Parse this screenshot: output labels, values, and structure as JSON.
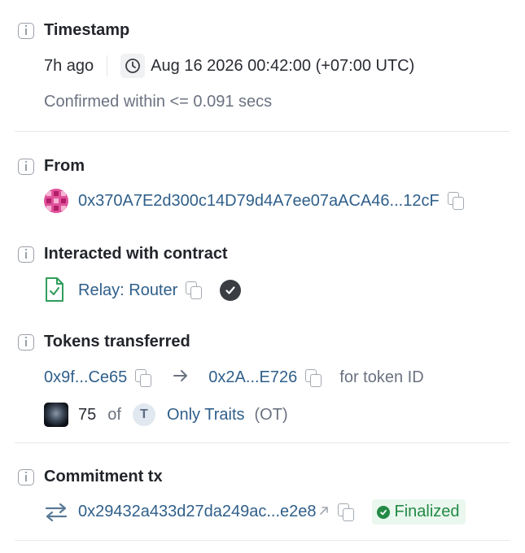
{
  "timestamp": {
    "heading": "Timestamp",
    "relative": "7h ago",
    "absolute": "Aug 16 2026 00:42:00 (+07:00 UTC)",
    "confirmed": "Confirmed within <= 0.091 secs"
  },
  "from": {
    "heading": "From",
    "address": "0x370A7E2d300c14D79d4A7ee07aACA46...12cF"
  },
  "contract": {
    "heading": "Interacted with contract",
    "name": "Relay: Router"
  },
  "tokens": {
    "heading": "Tokens transferred",
    "from_address": "0x9f...Ce65",
    "to_address": "0x2A...E726",
    "for_label": "for token ID",
    "amount": "75",
    "of_label": "of",
    "token_badge": "T",
    "token_name": "Only Traits",
    "token_symbol": "(OT)"
  },
  "commitment": {
    "heading": "Commitment tx",
    "hash": "0x29432a433d27da249ac...e2e8",
    "status": "Finalized"
  },
  "colors": {
    "link": "#2f5f8a",
    "muted": "#6b7280",
    "success": "#238a45",
    "success_bg": "#eaf7ee"
  }
}
